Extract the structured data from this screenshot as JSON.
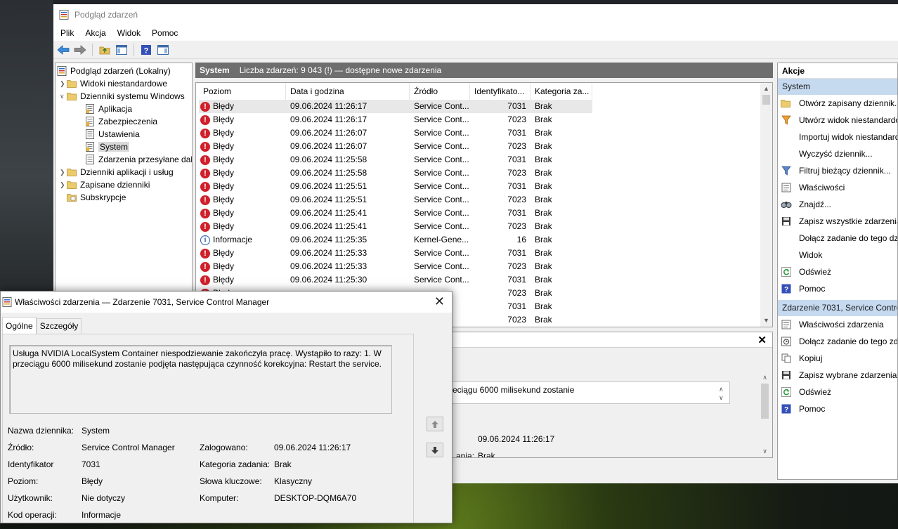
{
  "window": {
    "title": "Podgląd zdarzeń"
  },
  "menu": [
    "Plik",
    "Akcja",
    "Widok",
    "Pomoc"
  ],
  "toolbar": [
    "back-icon",
    "forward-icon",
    "up-folder-icon",
    "show-hide-tree-icon",
    "help-icon",
    "show-hide-actions-icon"
  ],
  "tree": {
    "root": "Podgląd zdarzeń (Lokalny)",
    "custom_views": "Widoki niestandardowe",
    "windows_logs": "Dzienniki systemu Windows",
    "application": "Aplikacja",
    "security": "Zabezpieczenia",
    "setup": "Ustawienia",
    "system": "System",
    "forwarded": "Zdarzenia przesyłane dalej",
    "app_service_logs": "Dzienniki aplikacji i usług",
    "saved_logs": "Zapisane dzienniki",
    "subscriptions": "Subskrypcje"
  },
  "center": {
    "log_name": "System",
    "count_text": "Liczba zdarzeń: 9 043 (!) — dostępne nowe zdarzenia"
  },
  "grid": {
    "columns": [
      "Poziom",
      "Data i godzina",
      "Źródło",
      "Identyfikato...",
      "Kategoria za..."
    ],
    "rows": [
      {
        "level": "Błędy",
        "icon": "error",
        "date": "09.06.2024 11:26:17",
        "source": "Service Cont...",
        "id": "7031",
        "category": "Brak"
      },
      {
        "level": "Błędy",
        "icon": "error",
        "date": "09.06.2024 11:26:17",
        "source": "Service Cont...",
        "id": "7023",
        "category": "Brak"
      },
      {
        "level": "Błędy",
        "icon": "error",
        "date": "09.06.2024 11:26:07",
        "source": "Service Cont...",
        "id": "7031",
        "category": "Brak"
      },
      {
        "level": "Błędy",
        "icon": "error",
        "date": "09.06.2024 11:26:07",
        "source": "Service Cont...",
        "id": "7023",
        "category": "Brak"
      },
      {
        "level": "Błędy",
        "icon": "error",
        "date": "09.06.2024 11:25:58",
        "source": "Service Cont...",
        "id": "7031",
        "category": "Brak"
      },
      {
        "level": "Błędy",
        "icon": "error",
        "date": "09.06.2024 11:25:58",
        "source": "Service Cont...",
        "id": "7023",
        "category": "Brak"
      },
      {
        "level": "Błędy",
        "icon": "error",
        "date": "09.06.2024 11:25:51",
        "source": "Service Cont...",
        "id": "7031",
        "category": "Brak"
      },
      {
        "level": "Błędy",
        "icon": "error",
        "date": "09.06.2024 11:25:51",
        "source": "Service Cont...",
        "id": "7023",
        "category": "Brak"
      },
      {
        "level": "Błędy",
        "icon": "error",
        "date": "09.06.2024 11:25:41",
        "source": "Service Cont...",
        "id": "7031",
        "category": "Brak"
      },
      {
        "level": "Błędy",
        "icon": "error",
        "date": "09.06.2024 11:25:41",
        "source": "Service Cont...",
        "id": "7023",
        "category": "Brak"
      },
      {
        "level": "Informacje",
        "icon": "info",
        "date": "09.06.2024 11:25:35",
        "source": "Kernel-Gene...",
        "id": "16",
        "category": "Brak"
      },
      {
        "level": "Błędy",
        "icon": "error",
        "date": "09.06.2024 11:25:33",
        "source": "Service Cont...",
        "id": "7031",
        "category": "Brak"
      },
      {
        "level": "Błędy",
        "icon": "error",
        "date": "09.06.2024 11:25:33",
        "source": "Service Cont...",
        "id": "7023",
        "category": "Brak"
      },
      {
        "level": "Błędy",
        "icon": "error",
        "date": "09.06.2024 11:25:30",
        "source": "Service Cont...",
        "id": "7031",
        "category": "Brak"
      },
      {
        "level": "Błędy",
        "icon": "error",
        "date": "",
        "source": "",
        "id": "7023",
        "category": "Brak"
      },
      {
        "level": "Błędy",
        "icon": "error",
        "date": "",
        "source": "",
        "id": "7031",
        "category": "Brak"
      },
      {
        "level": "Błędy",
        "icon": "error",
        "date": "",
        "source": "",
        "id": "7023",
        "category": "Brak"
      }
    ]
  },
  "lower": {
    "text": "yła pracę. Wystąpiło to razy: 1. W przeciągu 6000 milisekund zostanie",
    "logged": "09.06.2024 11:26:17",
    "task_partial": "ania:",
    "task_value": "Brak"
  },
  "actions": {
    "title": "Akcje",
    "section1": "System",
    "items1": [
      {
        "label": "Otwórz zapisany dziennik...",
        "icon": "open-folder-icon"
      },
      {
        "label": "Utwórz widok niestandardowy...",
        "icon": "filter-create-icon"
      },
      {
        "label": "Importuj widok niestandardowy...",
        "icon": ""
      },
      {
        "label": "Wyczyść dziennik...",
        "icon": ""
      },
      {
        "label": "Filtruj bieżący dziennik...",
        "icon": "filter-icon"
      },
      {
        "label": "Właściwości",
        "icon": "properties-icon"
      },
      {
        "label": "Znajdź...",
        "icon": "find-icon"
      },
      {
        "label": "Zapisz wszystkie zdarzenia jako...",
        "icon": "save-icon"
      },
      {
        "label": "Dołącz zadanie do tego dziennika...",
        "icon": ""
      },
      {
        "label": "Widok",
        "icon": ""
      },
      {
        "label": "Odśwież",
        "icon": "refresh-icon"
      },
      {
        "label": "Pomoc",
        "icon": "help-icon"
      }
    ],
    "section2": "Zdarzenie 7031, Service Control Manager",
    "items2": [
      {
        "label": "Właściwości zdarzenia",
        "icon": "properties-icon"
      },
      {
        "label": "Dołącz zadanie do tego zdarzenia...",
        "icon": "task-icon"
      },
      {
        "label": "Kopiuj",
        "icon": "copy-icon"
      },
      {
        "label": "Zapisz wybrane zdarzenia...",
        "icon": "save-icon"
      },
      {
        "label": "Odśwież",
        "icon": "refresh-icon"
      },
      {
        "label": "Pomoc",
        "icon": "help-icon"
      }
    ]
  },
  "dialog": {
    "title": "Właściwości zdarzenia — Zdarzenie 7031, Service Control Manager",
    "tab_general": "Ogólne",
    "tab_details": "Szczegóły",
    "description": "Usługa NVIDIA LocalSystem Container niespodziewanie zakończyła pracę. Wystąpiło to razy: 1. W przeciągu 6000 milisekund zostanie podjęta następująca czynność korekcyjna: Restart the service.",
    "labels": {
      "log_name": "Nazwa dziennika:",
      "source": "Źródło:",
      "id": "Identyfikator",
      "level": "Poziom:",
      "user": "Użytkownik:",
      "opcode": "Kod operacji:",
      "logged": "Zalogowano:",
      "task": "Kategoria zadania:",
      "keywords": "Słowa kluczowe:",
      "computer": "Komputer:"
    },
    "values": {
      "log_name": "System",
      "source": "Service Control Manager",
      "id": "7031",
      "level": "Błędy",
      "user": "Nie dotyczy",
      "opcode": "Informacje",
      "logged": "09.06.2024 11:26:17",
      "task": "Brak",
      "keywords": "Klasyczny",
      "computer": "DESKTOP-DQM6A70"
    }
  }
}
